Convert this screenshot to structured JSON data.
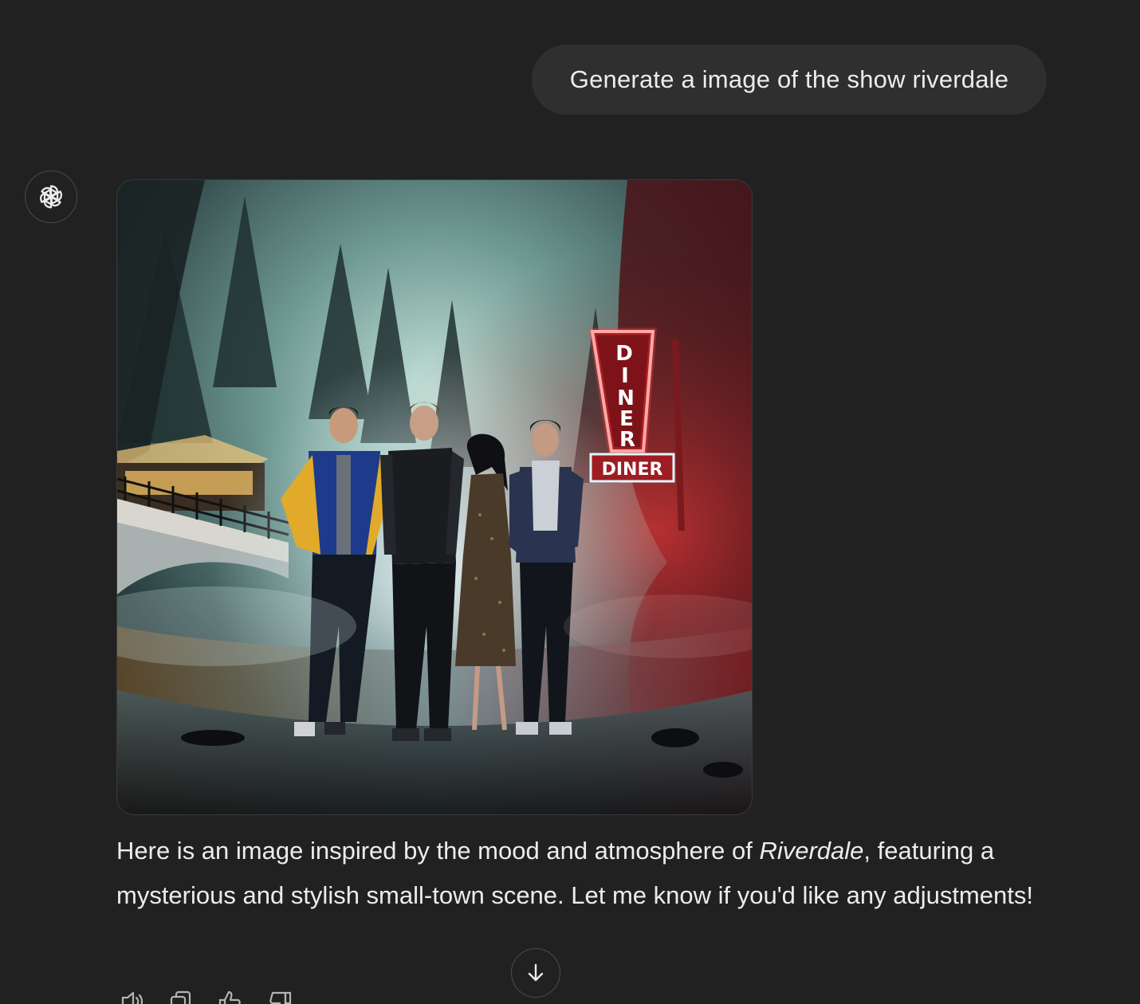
{
  "user_message": "Generate a image of the show riverdale",
  "assistant": {
    "avatar_icon": "openai-logo-icon",
    "image": {
      "sign_vertical": [
        "D",
        "I",
        "N",
        "E",
        "R"
      ],
      "sign_horizontal": "DINER"
    },
    "response_before": "Here is an image inspired by the mood and atmosphere of ",
    "response_italic": "Riverdale",
    "response_after": ", featuring a mysterious and stylish small-town scene. Let me know if you'd like any adjustments!",
    "actions": [
      {
        "icon": "speaker-icon"
      },
      {
        "icon": "copy-icon"
      },
      {
        "icon": "thumbs-up-icon"
      },
      {
        "icon": "thumbs-down-icon"
      }
    ]
  },
  "scroll_button_icon": "arrow-down-icon",
  "colors": {
    "background": "#212121",
    "bubble": "#2f2f2f",
    "text": "#ececec",
    "neon_red": "#ff3b3b"
  }
}
